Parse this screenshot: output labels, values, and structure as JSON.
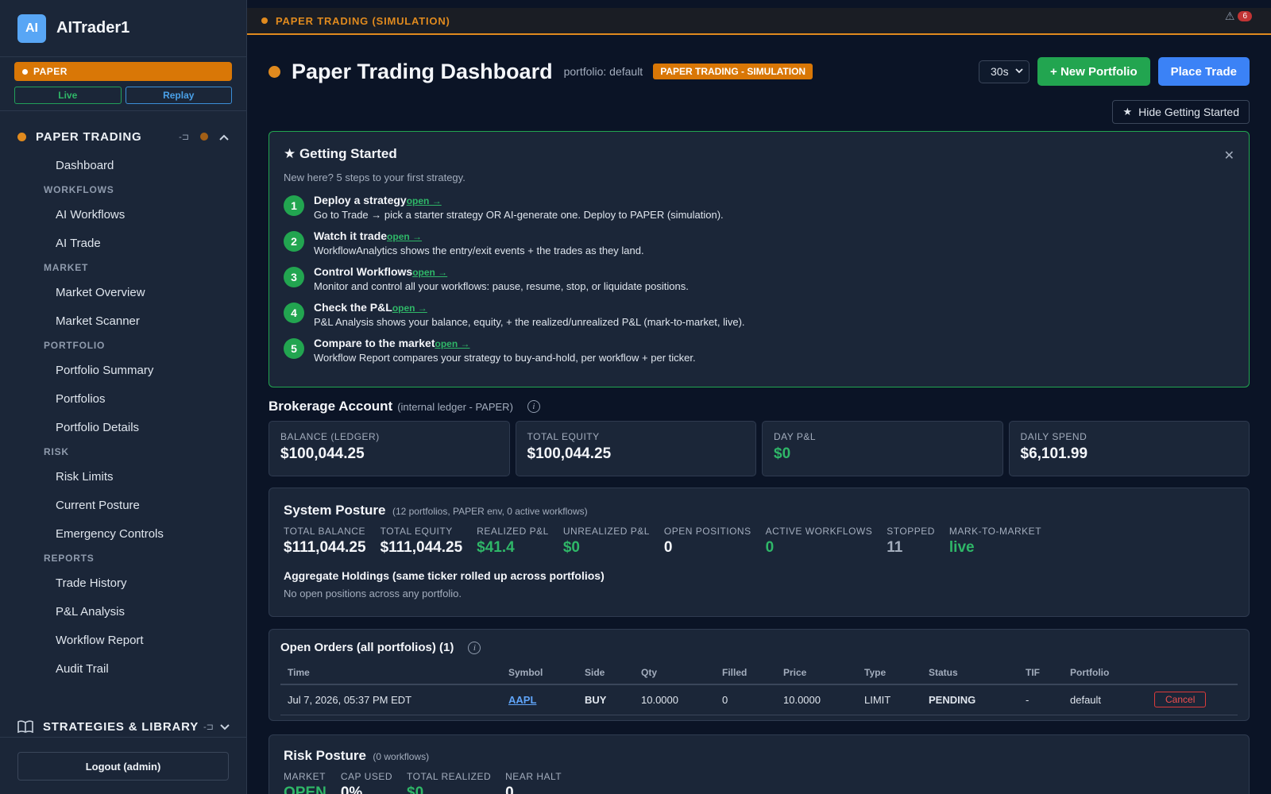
{
  "sidebar": {
    "logo": "AI",
    "app_name": "AITrader1",
    "mode_pill": "PAPER",
    "live_label": "Live",
    "replay_label": "Replay",
    "section_title": "PAPER TRADING",
    "pin_glyph": "-⊐",
    "chevron_up": "^",
    "nav": {
      "dashboard": "Dashboard",
      "workflows_group": "WORKFLOWS",
      "ai_workflows": "AI Workflows",
      "ai_trade": "AI Trade",
      "market_group": "MARKET",
      "market_overview": "Market Overview",
      "market_scanner": "Market Scanner",
      "portfolio_group": "PORTFOLIO",
      "portfolio_summary": "Portfolio Summary",
      "portfolios": "Portfolios",
      "portfolio_details": "Portfolio Details",
      "risk_group": "RISK",
      "risk_limits": "Risk Limits",
      "current_posture": "Current Posture",
      "emergency_controls": "Emergency Controls",
      "reports_group": "REPORTS",
      "trade_history": "Trade History",
      "pnl_analysis": "P&L Analysis",
      "workflow_report": "Workflow Report",
      "audit_trail": "Audit Trail"
    },
    "strategies_title": "STRATEGIES & LIBRARY",
    "logout_label": "Logout (admin)"
  },
  "banner": {
    "text": "PAPER TRADING (SIMULATION)",
    "alert_count": "6"
  },
  "header": {
    "title": "Paper Trading Dashboard",
    "portfolio_label": "portfolio: default",
    "sim_badge": "PAPER TRADING - SIMULATION",
    "interval": "30s",
    "new_portfolio": "+ New Portfolio",
    "place_trade": "Place Trade",
    "hide_getting_started": "Hide Getting Started"
  },
  "getting_started": {
    "title": "★ Getting Started",
    "subtitle": "New here? 5 steps to your first strategy.",
    "steps": [
      {
        "num": "1",
        "title": "Deploy a strategy",
        "link": "open →",
        "desc": "Go to Trade → pick a starter strategy OR AI-generate one. Deploy to PAPER (simulation)."
      },
      {
        "num": "2",
        "title": "Watch it trade",
        "link": "open →",
        "desc": "WorkflowAnalytics shows the entry/exit events + the trades as they land."
      },
      {
        "num": "3",
        "title": "Control Workflows",
        "link": "open →",
        "desc": "Monitor and control all your workflows: pause, resume, stop, or liquidate positions."
      },
      {
        "num": "4",
        "title": "Check the P&L",
        "link": "open →",
        "desc": "P&L Analysis shows your balance, equity, + the realized/unrealized P&L (mark-to-market, live)."
      },
      {
        "num": "5",
        "title": "Compare to the market",
        "link": "open →",
        "desc": "Workflow Report compares your strategy to buy-and-hold, per workflow + per ticker."
      }
    ]
  },
  "brokerage": {
    "title": "Brokerage Account",
    "subtitle": "(internal ledger - PAPER)",
    "cards": [
      {
        "label": "BALANCE (LEDGER)",
        "value": "$100,044.25"
      },
      {
        "label": "TOTAL EQUITY",
        "value": "$100,044.25"
      },
      {
        "label": "DAY P&L",
        "value": "$0"
      },
      {
        "label": "DAILY SPEND",
        "value": "$6,101.99"
      }
    ]
  },
  "posture": {
    "title": "System Posture",
    "subtitle": "(12 portfolios, PAPER env, 0 active workflows)",
    "metrics": [
      {
        "label": "TOTAL BALANCE",
        "value": "$111,044.25"
      },
      {
        "label": "TOTAL EQUITY",
        "value": "$111,044.25"
      },
      {
        "label": "REALIZED P&L",
        "value": "$41.4"
      },
      {
        "label": "UNREALIZED P&L",
        "value": "$0"
      },
      {
        "label": "OPEN POSITIONS",
        "value": "0"
      },
      {
        "label": "ACTIVE WORKFLOWS",
        "value": "0"
      },
      {
        "label": "STOPPED",
        "value": "11"
      },
      {
        "label": "MARK-TO-MARKET",
        "value": "live"
      }
    ],
    "aggregate_title": "Aggregate Holdings (same ticker rolled up across portfolios)",
    "aggregate_empty": "No open positions across any portfolio."
  },
  "orders": {
    "title": "Open Orders (all portfolios) (1)",
    "columns": [
      "Time",
      "Symbol",
      "Side",
      "Qty",
      "Filled",
      "Price",
      "Type",
      "Status",
      "TIF",
      "Portfolio",
      ""
    ],
    "rows": [
      {
        "time": "Jul 7, 2026, 05:37 PM EDT",
        "symbol": "AAPL",
        "side": "BUY",
        "qty": "10.0000",
        "filled": "0",
        "price": "10.0000",
        "type": "LIMIT",
        "status": "PENDING",
        "tif": "-",
        "portfolio": "default",
        "action": "Cancel"
      }
    ]
  },
  "risk": {
    "title": "Risk Posture",
    "subtitle": "(0 workflows)",
    "metrics": [
      {
        "label": "MARKET",
        "value": "OPEN"
      },
      {
        "label": "CAP USED",
        "value": "0%"
      },
      {
        "label": "TOTAL REALIZED",
        "value": "$0"
      },
      {
        "label": "NEAR HALT",
        "value": "0"
      }
    ]
  },
  "colors": {
    "accent_orange": "#e08a1e",
    "accent_green": "#22a550",
    "accent_blue": "#3b82f6",
    "danger_red": "#dc3b3b"
  }
}
